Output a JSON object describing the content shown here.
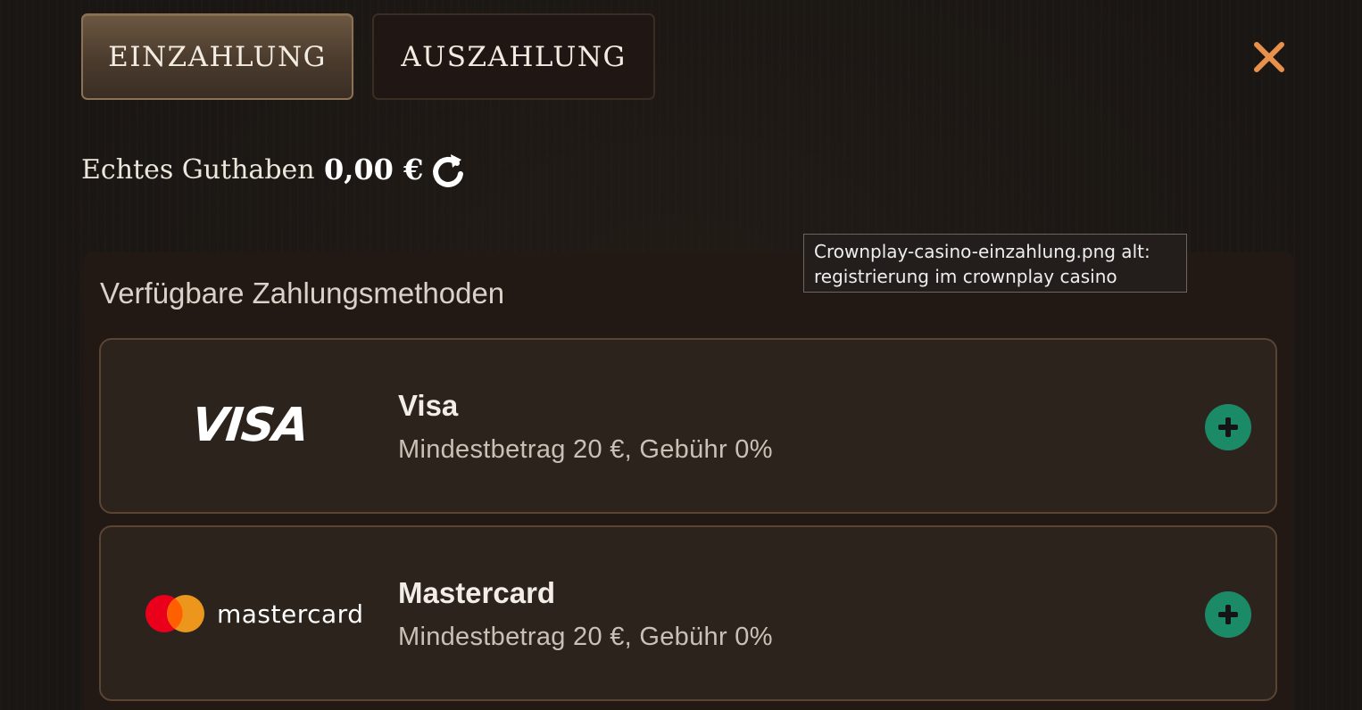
{
  "tabs": {
    "deposit_label": "EINZAHLUNG",
    "withdraw_label": "AUSZAHLUNG",
    "active": "deposit"
  },
  "balance": {
    "label": "Echtes Guthaben",
    "value": "0,00 €"
  },
  "payment_methods": {
    "title": "Verfügbare Zahlungsmethoden",
    "items": [
      {
        "name": "Visa",
        "description": "Mindestbetrag 20 €, Gebühr 0%",
        "logo_text": "VISA"
      },
      {
        "name": "Mastercard",
        "description": "Mindestbetrag 20 €, Gebühr 0%",
        "logo_text": "mastercard"
      }
    ]
  },
  "tooltip": {
    "line1": "Crownplay-casino-einzahlung.png alt:",
    "line2": "registrierung im crownplay casino"
  },
  "icons": {
    "close": "close-icon",
    "refresh": "refresh-icon",
    "add": "plus-circle-icon"
  },
  "colors": {
    "accent_close": "#e8914a",
    "add_button": "#1b8a66",
    "mastercard_red": "#eb001b",
    "mastercard_orange": "#f79e1b"
  }
}
